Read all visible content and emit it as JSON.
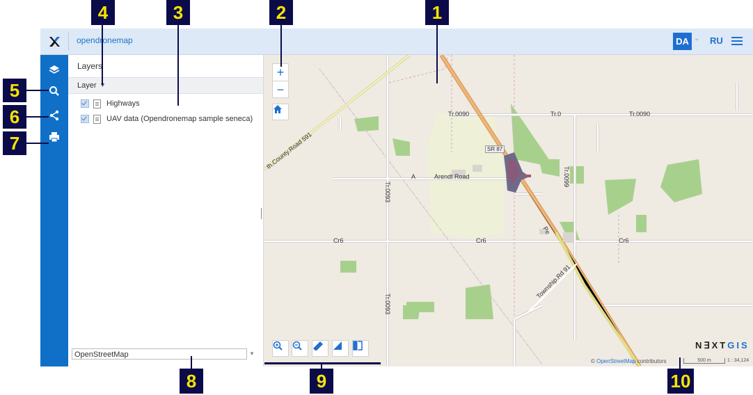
{
  "header": {
    "app_title": "opendronemap",
    "lang_active": "DA",
    "lang_other": "RU"
  },
  "panel": {
    "title": "Layers",
    "layer_dropdown": "Layer",
    "layers": [
      {
        "label": "Highways",
        "checked": true
      },
      {
        "label": "UAV data (Opendronemap sample seneca)",
        "checked": true
      }
    ],
    "basemap": "OpenStreetMap"
  },
  "map": {
    "labels": {
      "tr0090": "Tr.0090",
      "tr0": "Tr.0",
      "tr0090b": "Tr.0090",
      "sr87": "SR 87",
      "arendt": "Arendt Road",
      "a": "A",
      "tr0099": "Tr.0099",
      "tr0093": "Tr.0093",
      "tr0093b": "Tr.0093",
      "cr6a": "Cr6",
      "cr6b": "Cr6",
      "cr6c": "Cr6",
      "county591": "th.County.Road 591",
      "township91": "Township.Rd 91",
      "pe": "Pe"
    },
    "logo": {
      "prefix": "N∃XT",
      "suffix": "GIS"
    },
    "attribution_prefix": "© ",
    "attribution_link": "OpenStreetMap",
    "attribution_suffix": " contributors",
    "scale_label": "500 m",
    "scale_ratio": "1 : 34,124"
  },
  "callouts": [
    "1",
    "2",
    "3",
    "4",
    "5",
    "6",
    "7",
    "8",
    "9",
    "10"
  ],
  "colors": {
    "accent": "#1070c8",
    "callout_bg": "#0b0b4a",
    "callout_fg": "#f5e400",
    "map_bg": "#efeae2",
    "forest": "#a8d08d"
  }
}
